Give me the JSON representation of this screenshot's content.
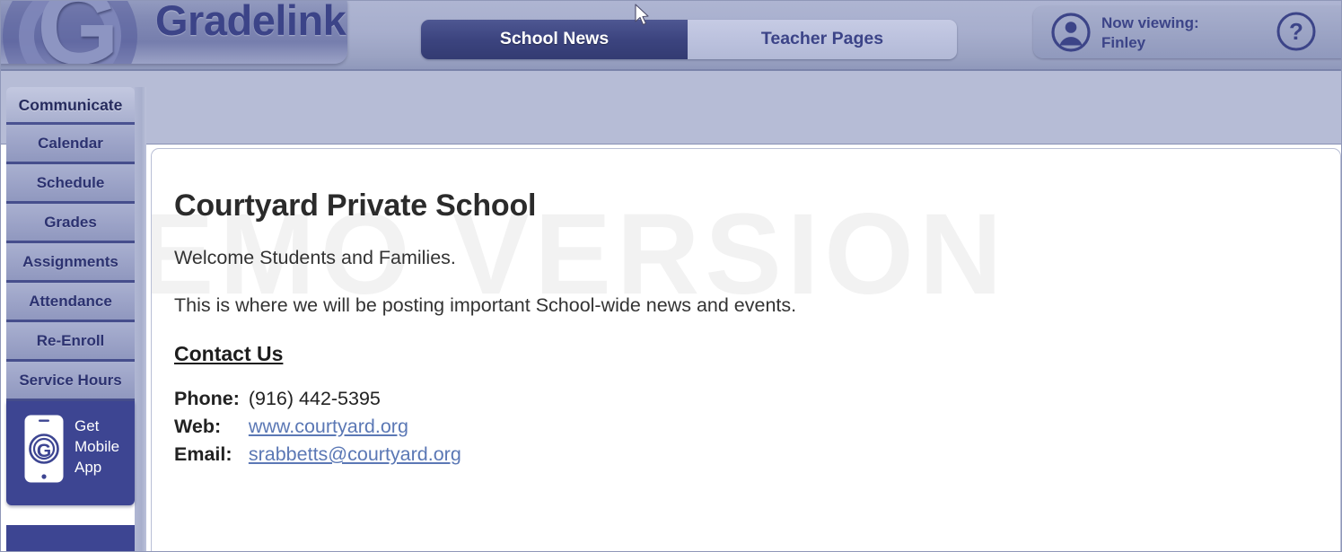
{
  "header": {
    "logo_text": "Gradelink",
    "logo_mark": "G",
    "tabs": [
      {
        "label": "School News",
        "active": true
      },
      {
        "label": "Teacher Pages",
        "active": false
      }
    ],
    "now_viewing_label": "Now viewing:",
    "now_viewing_name": "Finley",
    "help_glyph": "?",
    "avatar_icon": "user-avatar-icon",
    "help_icon": "question-mark-help-icon"
  },
  "sidebar": {
    "section_title": "Communicate",
    "items": [
      {
        "label": "Calendar"
      },
      {
        "label": "Schedule"
      },
      {
        "label": "Grades"
      },
      {
        "label": "Assignments"
      },
      {
        "label": "Attendance"
      },
      {
        "label": "Re-Enroll"
      },
      {
        "label": "Service Hours"
      }
    ],
    "mobile_app": {
      "line1": "Get",
      "line2": "Mobile",
      "line3": "App",
      "icon": "mobile-phone-icon",
      "icon_glyph": "G"
    }
  },
  "main": {
    "watermark": "EMO VERSION",
    "title": "Courtyard Private School",
    "paragraph1": "Welcome Students and Families.",
    "paragraph2": "This is where we will be posting important School-wide news and events.",
    "contact_heading": "Contact Us",
    "contact_rows": [
      {
        "label": "Phone:",
        "value": "(916) 442-5395",
        "link": false
      },
      {
        "label": "Web:",
        "value": "www.courtyard.org",
        "link": true
      },
      {
        "label": "Email:",
        "value": "srabbetts@courtyard.org",
        "link": true
      }
    ]
  },
  "colors": {
    "brand_dark": "#3c4488",
    "brand_mid": "#9098bf",
    "brand_light": "#b6bcd6",
    "panel_bg": "#ffffff",
    "link": "#5b78b5",
    "watermark": "#f2f2f2",
    "sidebar_app_bg": "#3d4592"
  }
}
